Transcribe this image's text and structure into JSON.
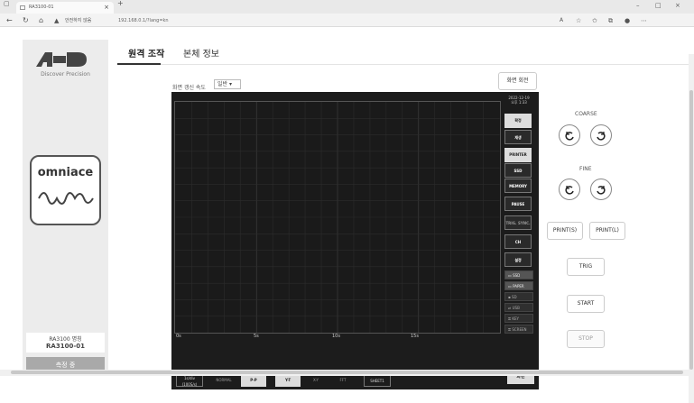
{
  "browser": {
    "tab_title": "RA3100-01",
    "security_label": "안전하지 않음",
    "address": "192.168.0.1/?lang=kn"
  },
  "tabs": [
    {
      "label": "원격 조작"
    },
    {
      "label": "본체 정보"
    }
  ],
  "sidebar": {
    "logo_sub": "Discover Precision",
    "product": "omniace",
    "device_label": "RA3100 명칭",
    "device_name": "RA3100-01",
    "status": "측정 중"
  },
  "toolbar": {
    "speed_label": "화면 갱신 속도",
    "speed_value": "일반",
    "rotate_label": "화면 회전"
  },
  "scope": {
    "date": "2022-12-19",
    "time": "오후 1:33",
    "x_ticks": [
      "0s",
      "5s",
      "10s",
      "15s"
    ],
    "controls": {
      "c1": "확정",
      "c2": "재생",
      "printer": "PRINTER",
      "ssd": "SSD",
      "memory": "MEMORY",
      "pause": "PAUSE",
      "trig_sync": "TRIG. SYNC.",
      "ch": "CH",
      "settings": "설정"
    },
    "indicators": [
      "SSD",
      "PAPER",
      "SD",
      "USB",
      "KEY",
      "SCREEN"
    ],
    "bottom": {
      "timediv": "1s/div",
      "rate": "(100S/s)",
      "normal": "NORMAL",
      "pp": "P-P",
      "yt": "Y-T",
      "xy": "X-Y",
      "fft": "FFT",
      "sheet": "SHEET1",
      "display": "화면"
    }
  },
  "right_panel": {
    "coarse": "COARSE",
    "fine": "FINE",
    "print_s": "PRINT(S)",
    "print_l": "PRINT(L)",
    "trig": "TRIG",
    "start": "START",
    "stop": "STOP"
  },
  "colors": {
    "scope_bg": "#1c1c1c",
    "sidebar_bg": "#ececec",
    "status_bg": "#a9a9a9"
  }
}
